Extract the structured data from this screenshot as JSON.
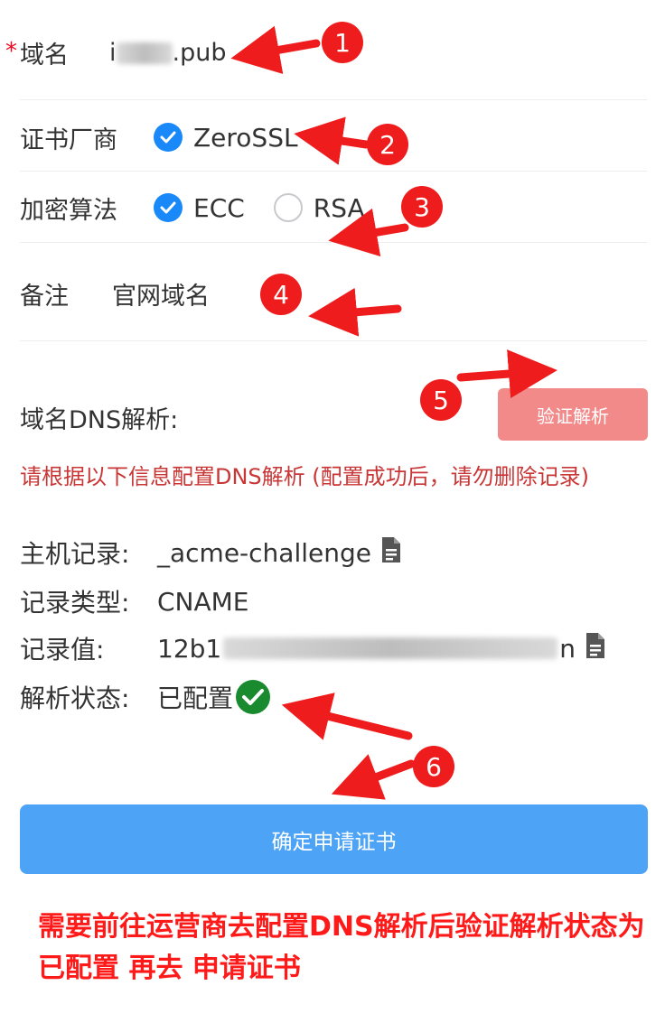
{
  "form": {
    "domain": {
      "label": "域名",
      "required_mark": "*",
      "value_prefix": "i",
      "value_suffix": ".pub"
    },
    "vendor": {
      "label": "证书厂商",
      "option": "ZeroSSL"
    },
    "algorithm": {
      "label": "加密算法",
      "options": [
        {
          "label": "ECC",
          "checked": true
        },
        {
          "label": "RSA",
          "checked": false
        }
      ]
    },
    "remark": {
      "label": "备注",
      "value": "官网域名"
    }
  },
  "dns": {
    "section_label": "域名DNS解析:",
    "verify_button": "验证解析",
    "warning": "请根据以下信息配置DNS解析 (配置成功后，请勿删除记录)",
    "host": {
      "label": "主机记录:",
      "value": "_acme-challenge"
    },
    "type": {
      "label": "记录类型:",
      "value": "CNAME"
    },
    "record": {
      "label": "记录值:",
      "value_prefix": "12b1",
      "value_suffix": "n"
    },
    "status": {
      "label": "解析状态:",
      "value": "已配置"
    }
  },
  "apply_button": "确定申请证书",
  "note": "需要前往运营商去配置DNS解析后验证解析状态为 已配置 再去 申请证书",
  "annotations": [
    "1",
    "2",
    "3",
    "4",
    "5",
    "6"
  ],
  "colors": {
    "primary": "#1989fa",
    "danger": "#ee1c1c",
    "success": "#1a8a2e",
    "apply_btn": "#4da3f6",
    "verify_btn": "#f28a8a"
  }
}
